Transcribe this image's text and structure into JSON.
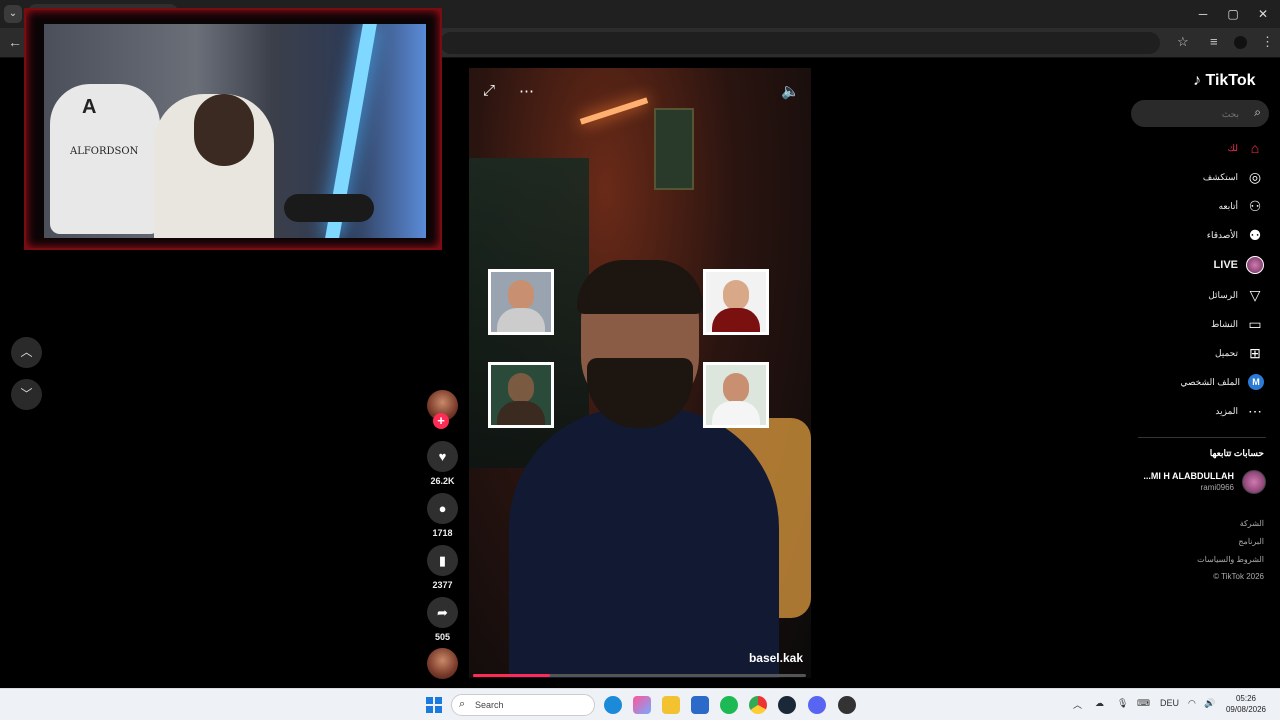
{
  "browser": {
    "tab_dropdown_icon": "chevron-down-icon",
    "window_controls": [
      "─",
      "▢",
      "✕"
    ]
  },
  "webcam": {
    "chair_logo": "A",
    "chair_text": "ALFORDSON"
  },
  "video": {
    "author": "basel.kak",
    "progress": 0.23
  },
  "actions": {
    "likes": "26.2K",
    "comments": "1718",
    "bookmarks": "2377",
    "shares": "505"
  },
  "sidebar": {
    "logo": "TikTok",
    "search_placeholder": "بحث",
    "nav": [
      {
        "label": "لك",
        "icon": "home-icon",
        "glyph": "⌂"
      },
      {
        "label": "استكشف",
        "icon": "compass-icon",
        "glyph": "◎"
      },
      {
        "label": "أتابعه",
        "icon": "user-plus-icon",
        "glyph": "⚇"
      },
      {
        "label": "الأصدقاء",
        "icon": "friends-icon",
        "glyph": "⚉"
      },
      {
        "label": "LIVE",
        "icon": "live-avatar-icon",
        "glyph": "●"
      },
      {
        "label": "الرسائل",
        "icon": "send-icon",
        "glyph": "▽"
      },
      {
        "label": "النشاط",
        "icon": "activity-icon",
        "glyph": "▭"
      },
      {
        "label": "تحميل",
        "icon": "upload-icon",
        "glyph": "⊞"
      },
      {
        "label": "الملف الشخصي",
        "icon": "profile-icon",
        "glyph": "M"
      },
      {
        "label": "المزيد",
        "icon": "more-icon",
        "glyph": "⋯"
      }
    ],
    "following_title": "حسابات تتابعها",
    "account_name": "...MI H ALABDULLAH",
    "account_user": "rami0966",
    "footer": [
      "الشركة",
      "البرنامج",
      "الشروط والسياسات",
      "© TikTok 2026"
    ]
  },
  "taskbar": {
    "search_label": "Search",
    "lang": "DEU",
    "time": "05:26",
    "date": "09/08/2026"
  }
}
